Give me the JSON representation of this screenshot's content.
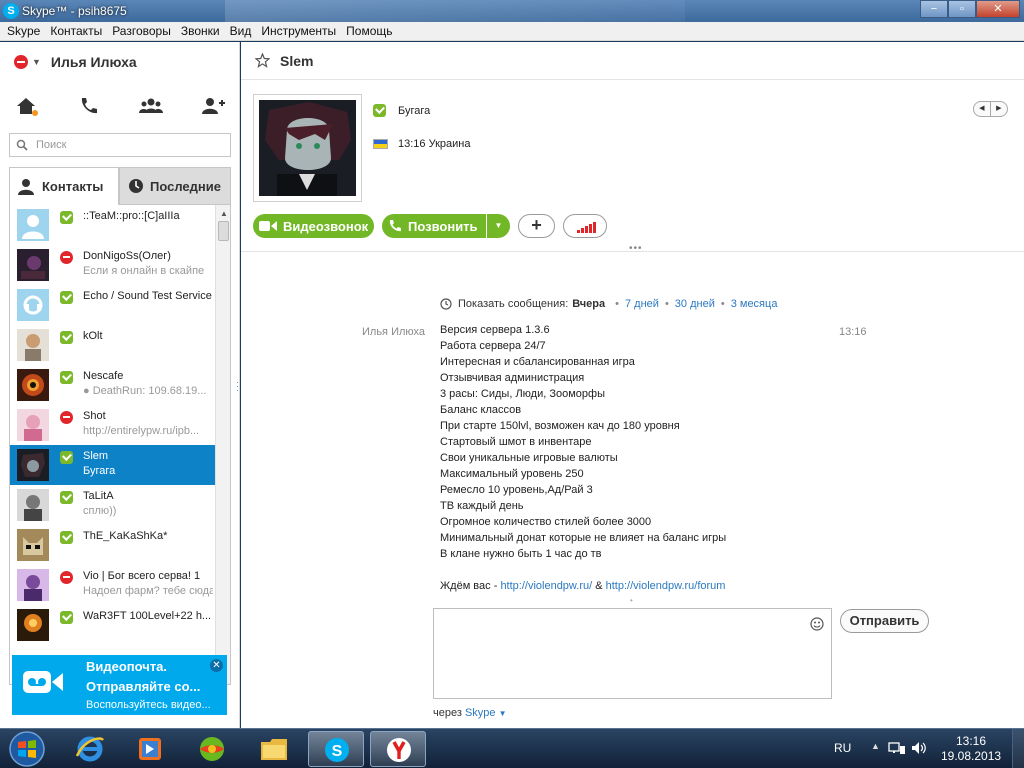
{
  "window": {
    "title": "Skype™ - psih8675",
    "minimize": "−",
    "maximize": "▫",
    "close": "✕"
  },
  "menu": [
    "Skype",
    "Контакты",
    "Разговоры",
    "Звонки",
    "Вид",
    "Инструменты",
    "Помощь"
  ],
  "user": {
    "name": "Илья Илюха"
  },
  "search": {
    "placeholder": "Поиск"
  },
  "tabs": {
    "contacts": "Контакты",
    "recent": "Последние"
  },
  "contacts": [
    {
      "name": "::TeaM::pro::[C]aIIIa",
      "sub": "",
      "status": "online"
    },
    {
      "name": "DonNigoSs(Олег)",
      "sub": "Если я онлайн в скайпе",
      "status": "busy"
    },
    {
      "name": "Echo / Sound Test Service",
      "sub": "",
      "status": "online"
    },
    {
      "name": "kOlt",
      "sub": "",
      "status": "online"
    },
    {
      "name": "Nescafe",
      "sub": "● DeathRun: 109.68.19...",
      "status": "online"
    },
    {
      "name": "Shot",
      "sub": "http://entirelypw.ru/ipb...",
      "status": "busy"
    },
    {
      "name": "Slem",
      "sub": "Бугага",
      "status": "online"
    },
    {
      "name": "TaLitA",
      "sub": "сплю))",
      "status": "online"
    },
    {
      "name": "ThE_KaKaShKa*",
      "sub": "",
      "status": "online"
    },
    {
      "name": "Vio | Бог всего серва! 1",
      "sub": "Надоел фарм? тебе сюда",
      "status": "busy"
    },
    {
      "name": "WaR3FT 100Level+22 h...",
      "sub": "",
      "status": "online"
    }
  ],
  "promo": {
    "title": "Видеопочта.",
    "line2": "Отправляйте со...",
    "line3": "Воспользуйтесь видео...",
    "close": "✕"
  },
  "conversation": {
    "title": "Slem",
    "mood": "Бугага",
    "location": "13:16 Украина",
    "video_call": "Видеозвонок",
    "call": "Позвонить",
    "plus": "+",
    "history": {
      "label": "Показать сообщения:",
      "active": "Вчера",
      "opt1": "7 дней",
      "opt2": "30 дней",
      "opt3": "3 месяца"
    },
    "message": {
      "author": "Илья Илюха",
      "time": "13:16",
      "lines": [
        "Версия сервера 1.3.6",
        "Работа сервера 24/7",
        "Интересная и сбалансированная игра",
        "Отзывчивая администрация",
        "3 расы: Сиды, Люди, Зооморфы",
        "Баланс классов",
        "При старте 150lvl, возможен кач до 180 уровня",
        "Стартовый шмот в инвентаре",
        "Свои уникальные игровые валюты",
        "Максимальный уровень 250",
        "Ремесло 10 уровень,Ад/Рай 3",
        "ТВ каждый день",
        "Огромное количество стилей более 3000",
        "Минимальный донат которые не влияет на баланс игры",
        "В клане нужно быть 1 час до тв"
      ],
      "footer_prefix": "Ждём вас - ",
      "link1": "http://violendpw.ru/",
      "amp": " & ",
      "link2": "http://violendpw.ru/forum"
    },
    "send": "Отправить",
    "via_prefix": "через",
    "via_service": "Skype"
  },
  "taskbar": {
    "lang": "RU",
    "time": "13:16",
    "date": "19.08.2013"
  },
  "colors": {
    "accent": "#00aff0",
    "green": "#72b826",
    "selected": "#0e82c6",
    "busy": "#e0262a"
  }
}
